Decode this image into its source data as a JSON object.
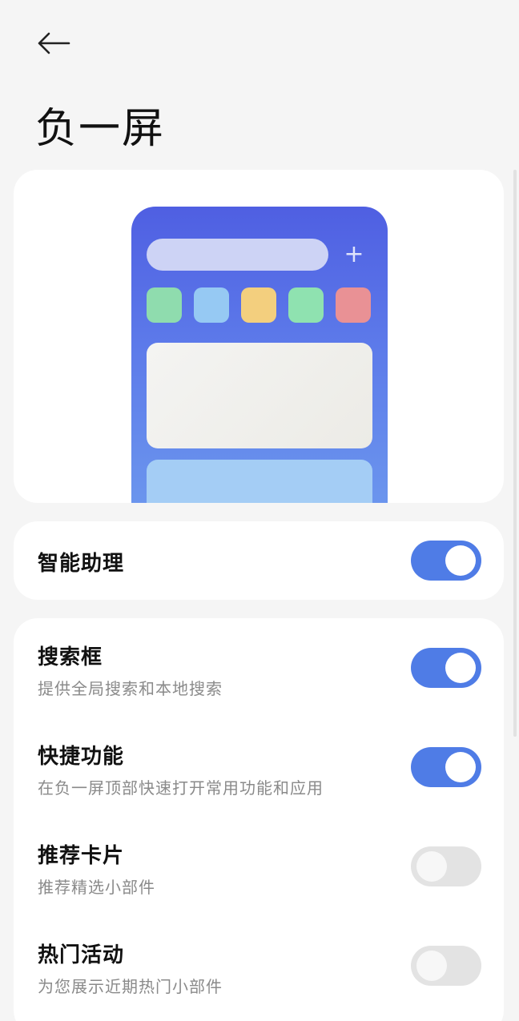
{
  "header": {
    "back_icon": "arrow-left-icon",
    "title": "负一屏"
  },
  "preview": {
    "plus_symbol": "+",
    "plus_icon": "plus-icon",
    "app_colors": [
      "#8fdcae",
      "#96c9f3",
      "#f3cf7e",
      "#8fe2b0",
      "#e99195"
    ]
  },
  "assistant": {
    "label": "智能助理",
    "enabled": true
  },
  "settings": {
    "items": [
      {
        "title": "搜索框",
        "subtitle": "提供全局搜索和本地搜索",
        "enabled": true
      },
      {
        "title": "快捷功能",
        "subtitle": "在负一屏顶部快速打开常用功能和应用",
        "enabled": true
      },
      {
        "title": "推荐卡片",
        "subtitle": "推荐精选小部件",
        "enabled": false
      },
      {
        "title": "热门活动",
        "subtitle": "为您展示近期热门小部件",
        "enabled": false
      }
    ]
  },
  "colors": {
    "accent": "#4f7ce6",
    "toggle_off": "#e3e3e3",
    "background": "#f5f5f5"
  }
}
